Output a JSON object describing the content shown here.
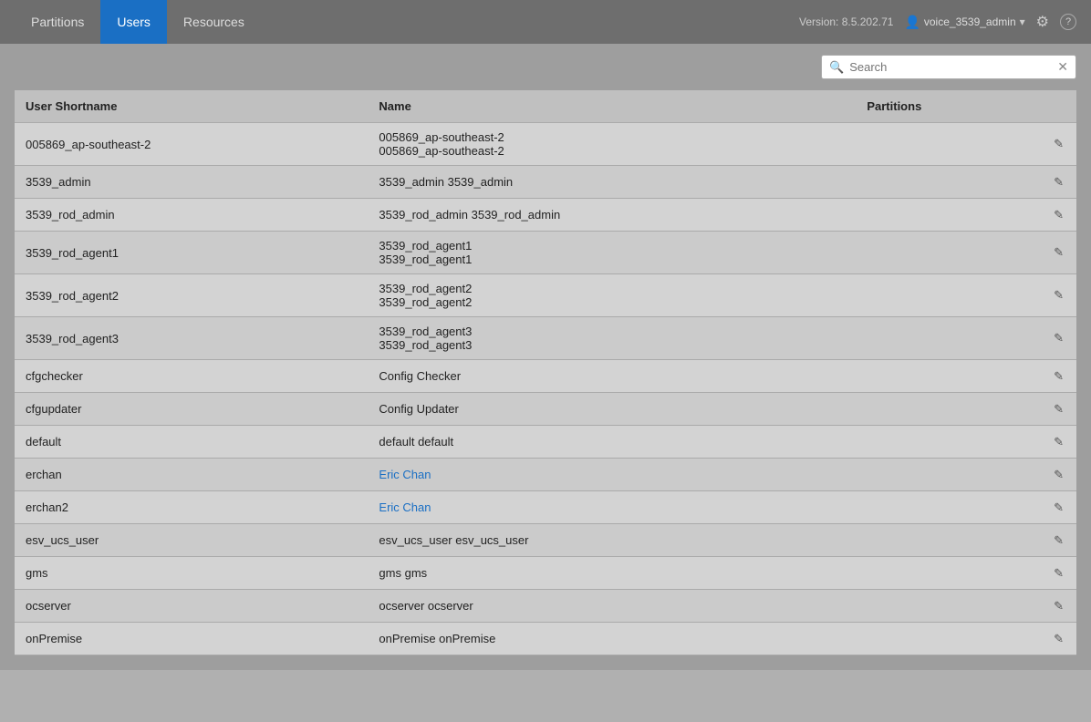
{
  "header": {
    "version": "Version: 8.5.202.71",
    "username": "voice_3539_admin",
    "tabs": [
      {
        "label": "Partitions",
        "id": "partitions",
        "active": false
      },
      {
        "label": "Users",
        "id": "users",
        "active": true
      },
      {
        "label": "Resources",
        "id": "resources",
        "active": false
      }
    ]
  },
  "search": {
    "placeholder": "Search"
  },
  "table": {
    "columns": [
      "User Shortname",
      "Name",
      "Partitions"
    ],
    "rows": [
      {
        "shortname": "005869_ap-southeast-2",
        "name_lines": [
          "005869_ap-southeast-2",
          "005869_ap-southeast-2"
        ],
        "partitions": "",
        "double": true
      },
      {
        "shortname": "3539_admin",
        "name_lines": [
          "3539_admin 3539_admin"
        ],
        "partitions": "",
        "double": false
      },
      {
        "shortname": "3539_rod_admin",
        "name_lines": [
          "3539_rod_admin 3539_rod_admin"
        ],
        "partitions": "",
        "double": false
      },
      {
        "shortname": "3539_rod_agent1",
        "name_lines": [
          "3539_rod_agent1",
          "3539_rod_agent1"
        ],
        "partitions": "",
        "double": true
      },
      {
        "shortname": "3539_rod_agent2",
        "name_lines": [
          "3539_rod_agent2",
          "3539_rod_agent2"
        ],
        "partitions": "",
        "double": true
      },
      {
        "shortname": "3539_rod_agent3",
        "name_lines": [
          "3539_rod_agent3",
          "3539_rod_agent3"
        ],
        "partitions": "",
        "double": true
      },
      {
        "shortname": "cfgchecker",
        "name_lines": [
          "Config Checker"
        ],
        "partitions": "",
        "double": false
      },
      {
        "shortname": "cfgupdater",
        "name_lines": [
          "Config Updater"
        ],
        "partitions": "",
        "double": false
      },
      {
        "shortname": "default",
        "name_lines": [
          "default default"
        ],
        "partitions": "",
        "double": false
      },
      {
        "shortname": "erchan",
        "name_lines": [
          "Eric Chan"
        ],
        "partitions": "",
        "double": false,
        "name_link": true
      },
      {
        "shortname": "erchan2",
        "name_lines": [
          "Eric Chan"
        ],
        "partitions": "",
        "double": false,
        "name_link": true
      },
      {
        "shortname": "esv_ucs_user",
        "name_lines": [
          "esv_ucs_user esv_ucs_user"
        ],
        "partitions": "",
        "double": false
      },
      {
        "shortname": "gms",
        "name_lines": [
          "gms gms"
        ],
        "partitions": "",
        "double": false
      },
      {
        "shortname": "ocserver",
        "name_lines": [
          "ocserver ocserver"
        ],
        "partitions": "",
        "double": false
      },
      {
        "shortname": "onPremise",
        "name_lines": [
          "onPremise onPremise"
        ],
        "partitions": "",
        "double": false
      }
    ]
  },
  "icons": {
    "search": "🔍",
    "clear": "✕",
    "user": "👤",
    "gear": "⚙",
    "help": "?",
    "edit": "✎",
    "chevron": "▾",
    "scrollbar": "▾"
  }
}
